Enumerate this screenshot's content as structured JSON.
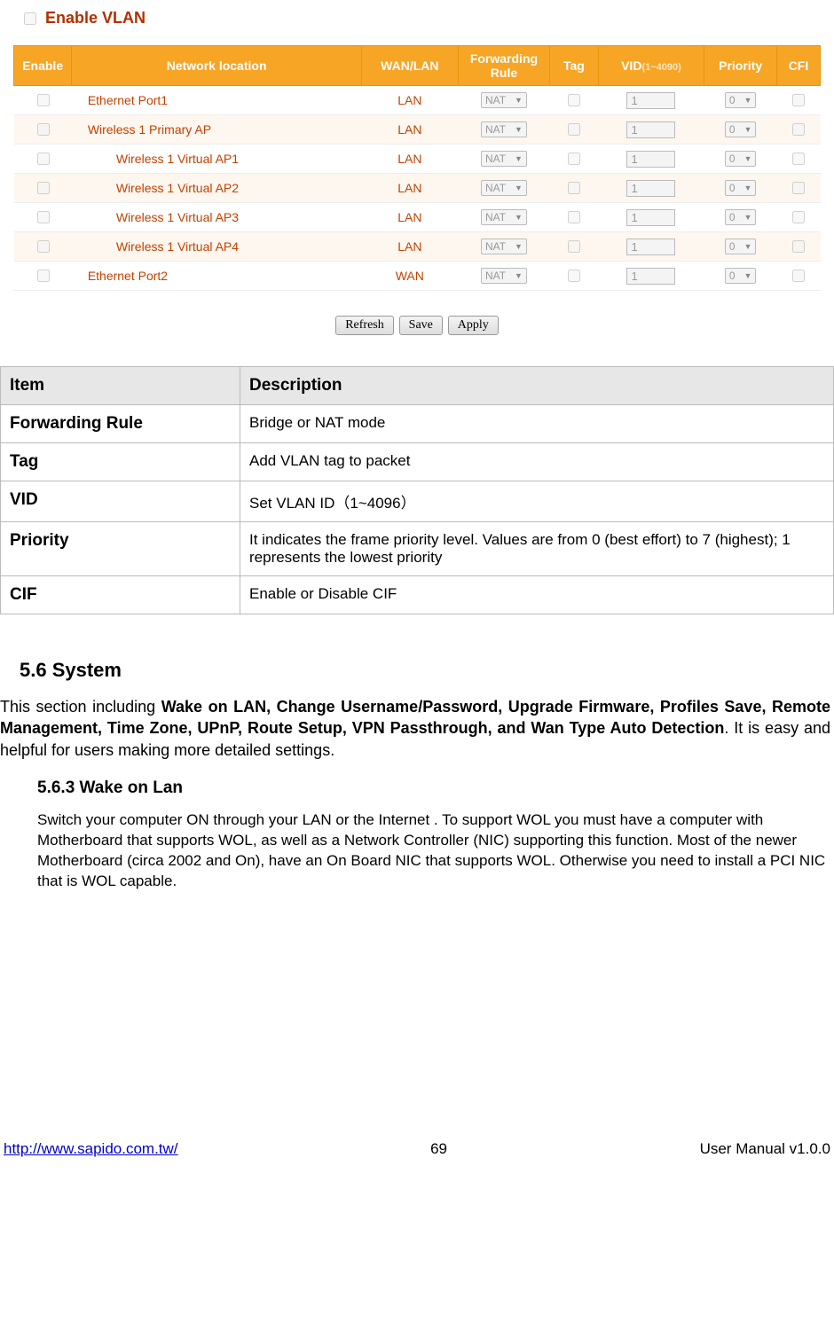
{
  "vlan": {
    "enable_label": "Enable VLAN",
    "headers": {
      "enable": "Enable",
      "location": "Network location",
      "wanlan": "WAN/LAN",
      "fwd": "Forwarding Rule",
      "tag": "Tag",
      "vid": "VID",
      "vid_hint": "(1~4090)",
      "priority": "Priority",
      "cfi": "CFI"
    },
    "rows": [
      {
        "name": "Ethernet Port1",
        "indent": false,
        "type": "LAN",
        "fwd": "NAT",
        "vid": "1",
        "prio": "0"
      },
      {
        "name": "Wireless 1 Primary AP",
        "indent": false,
        "type": "LAN",
        "fwd": "NAT",
        "vid": "1",
        "prio": "0"
      },
      {
        "name": "Wireless 1 Virtual AP1",
        "indent": true,
        "type": "LAN",
        "fwd": "NAT",
        "vid": "1",
        "prio": "0"
      },
      {
        "name": "Wireless 1 Virtual AP2",
        "indent": true,
        "type": "LAN",
        "fwd": "NAT",
        "vid": "1",
        "prio": "0"
      },
      {
        "name": "Wireless 1 Virtual AP3",
        "indent": true,
        "type": "LAN",
        "fwd": "NAT",
        "vid": "1",
        "prio": "0"
      },
      {
        "name": "Wireless 1 Virtual AP4",
        "indent": true,
        "type": "LAN",
        "fwd": "NAT",
        "vid": "1",
        "prio": "0"
      },
      {
        "name": "Ethernet Port2",
        "indent": false,
        "type": "WAN",
        "fwd": "NAT",
        "vid": "1",
        "prio": "0"
      }
    ],
    "buttons": {
      "refresh": "Refresh",
      "save": "Save",
      "apply": "Apply"
    }
  },
  "desc": {
    "headers": {
      "item": "Item",
      "description": "Description"
    },
    "rows": [
      {
        "item": "Forwarding Rule",
        "desc": "Bridge or NAT mode"
      },
      {
        "item": "Tag",
        "desc": "Add VLAN tag to packet"
      },
      {
        "item": "VID",
        "desc": "Set VLAN ID（1~4096）"
      },
      {
        "item": "Priority",
        "desc": " It indicates the frame priority level. Values are from 0 (best effort) to 7 (highest); 1 represents the lowest priority"
      },
      {
        "item": "CIF",
        "desc": "Enable or Disable CIF"
      }
    ]
  },
  "section": {
    "num_title": "5.6   System",
    "intro_prefix": "This section including ",
    "intro_bold": "Wake on LAN, Change Username/Password, Upgrade Firmware, Profiles Save, Remote Management, Time Zone, UPnP, Route Setup, VPN Passthrough, and Wan Type Auto Detection",
    "intro_suffix": ". It is easy and helpful for users making more detailed settings.",
    "sub_title": "5.6.3   Wake on Lan",
    "sub_text": "Switch your computer ON through your LAN or the Internet . To support WOL you must have a computer with Motherboard that supports WOL, as well as a Network Controller (NIC) supporting this function.   Most of the newer Motherboard (circa 2002 and On), have an On Board NIC that supports WOL.   Otherwise you need to install a PCI NIC that is WOL capable."
  },
  "footer": {
    "url": "http://www.sapido.com.tw/",
    "page": "69",
    "right": "User  Manual  v1.0.0"
  }
}
